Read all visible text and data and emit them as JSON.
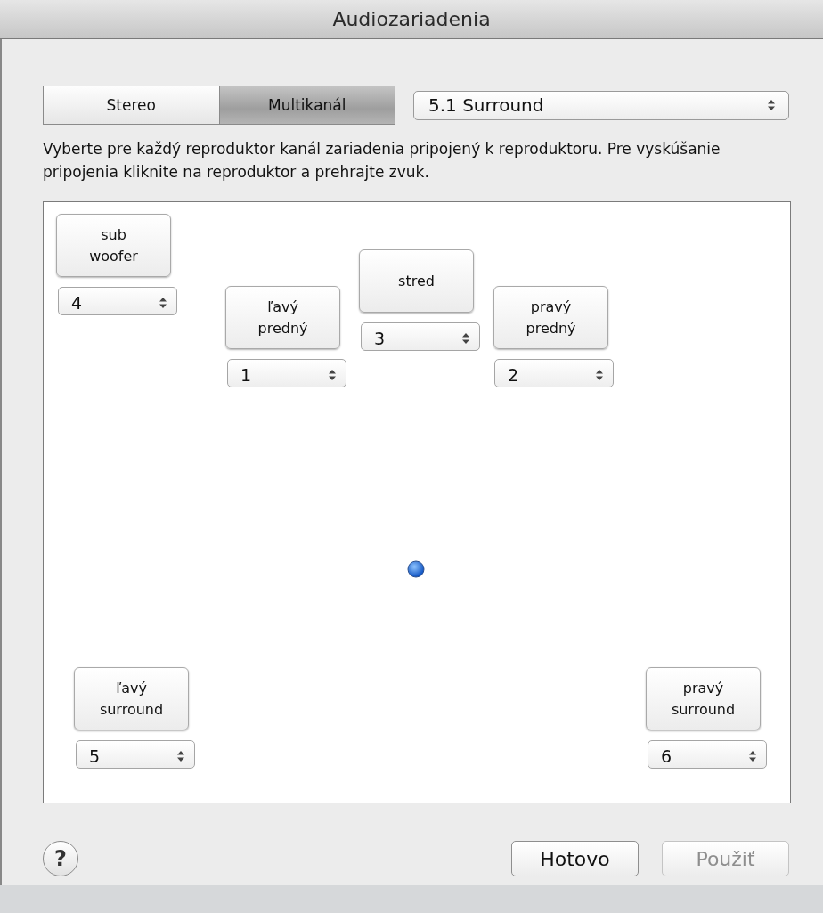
{
  "window": {
    "title": "Audiozariadenia"
  },
  "tabs": [
    {
      "label": "Stereo",
      "selected": false
    },
    {
      "label": "Multikanál",
      "selected": true
    }
  ],
  "layout_select": {
    "value": "5.1 Surround"
  },
  "instructions": "Vyberte pre každý reproduktor kanál zariadenia pripojený k reproduktoru. Pre vyskúšanie pripojenia kliknite na reproduktor a prehrajte zvuk.",
  "speakers": [
    {
      "label": "sub\nwoofer",
      "channel": "4"
    },
    {
      "label": "ľavý\npredný",
      "channel": "1"
    },
    {
      "label": "stred",
      "channel": "3"
    },
    {
      "label": "pravý\npredný",
      "channel": "2"
    },
    {
      "label": "ľavý\nsurround",
      "channel": "5"
    },
    {
      "label": "pravý\nsurround",
      "channel": "6"
    }
  ],
  "help_button": {
    "label": "?"
  },
  "buttons": [
    {
      "label": "Hotovo",
      "disabled": false
    },
    {
      "label": "Použiť",
      "disabled": true
    }
  ]
}
